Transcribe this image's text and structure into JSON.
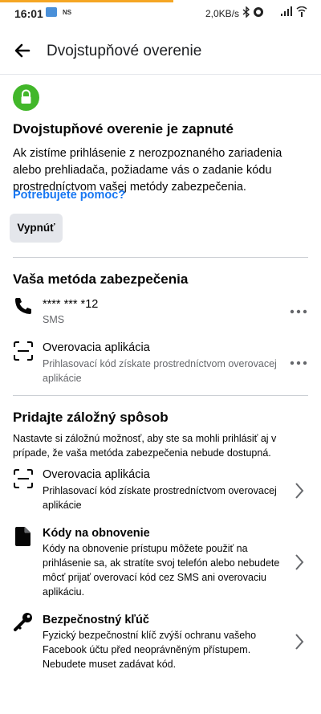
{
  "status_bar": {
    "time": "16:01",
    "ns_label": "NS",
    "speed": "2,0KB/s",
    "progress": 0.54
  },
  "header": {
    "title": "Dvojstupňové overenie"
  },
  "status_section": {
    "heading": "Dvojstupňové overenie je zapnuté",
    "description": "Ak zistíme prihlásenie z nerozpoznaného zariadenia alebo prehliadača, požiadame vás o zadanie kódu prostredníctvom vašej metódy zabezpečenia.",
    "help_link": "Potrebujete pomoc?",
    "turn_off_button": "Vypnúť",
    "accent_color": "#42b72a",
    "link_color": "#1877f2"
  },
  "method_section": {
    "title": "Vaša metóda zabezpečenia",
    "items": [
      {
        "title": "**** *** *12",
        "subtitle": "SMS",
        "icon": "phone-icon"
      },
      {
        "title": "Overovacia aplikácia",
        "subtitle": "Prihlasovací kód získate prostredníctvom overovacej aplikácie",
        "icon": "scan-icon"
      }
    ]
  },
  "backup_section": {
    "title": "Pridajte záložný spôsob",
    "description": "Nastavte si záložnú možnosť, aby ste sa mohli prihlásiť aj v prípade, že vaša metóda zabezpečenia nebude dostupná.",
    "items": [
      {
        "title": "Overovacia aplikácia",
        "subtitle": "Prihlasovací kód získate prostredníctvom overovacej aplikácie",
        "icon": "scan-icon"
      },
      {
        "title": "Kódy na obnovenie",
        "subtitle": "Kódy na obnovenie prístupu môžete použiť na prihlásenie sa, ak stratíte svoj telefón alebo nebudete môcť prijať overovací kód cez SMS ani overovaciu aplikáciu.",
        "icon": "document-icon"
      },
      {
        "title": "Bezpečnostný kľúč",
        "subtitle": "Fyzický bezpečnostní klíč zvýší ochranu vašeho Facebook účtu před neoprávněným přístupem. Nebudete muset zadávat kód.",
        "icon": "key-icon"
      }
    ]
  }
}
